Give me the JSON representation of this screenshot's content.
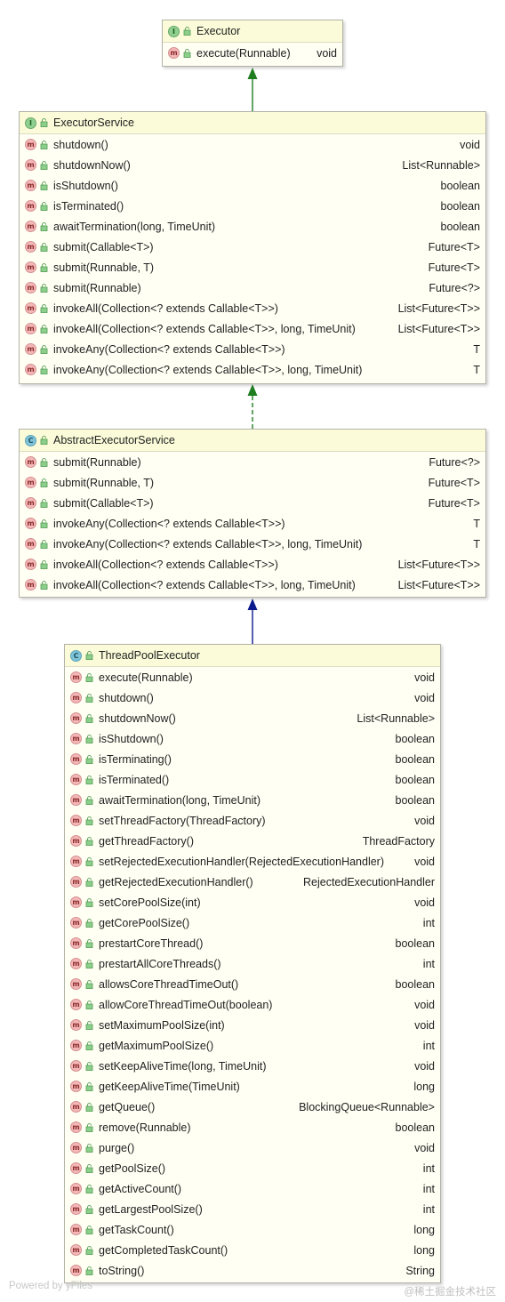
{
  "diagram": {
    "executor": {
      "title": "Executor",
      "kind_icon": "interface-icon",
      "methods": [
        {
          "name": "execute(Runnable)",
          "ret": "void"
        }
      ]
    },
    "executor_service": {
      "title": "ExecutorService",
      "kind_icon": "interface-icon",
      "methods": [
        {
          "name": "shutdown()",
          "ret": "void"
        },
        {
          "name": "shutdownNow()",
          "ret": "List<Runnable>"
        },
        {
          "name": "isShutdown()",
          "ret": "boolean"
        },
        {
          "name": "isTerminated()",
          "ret": "boolean"
        },
        {
          "name": "awaitTermination(long, TimeUnit)",
          "ret": "boolean"
        },
        {
          "name": "submit(Callable<T>)",
          "ret": "Future<T>"
        },
        {
          "name": "submit(Runnable, T)",
          "ret": "Future<T>"
        },
        {
          "name": "submit(Runnable)",
          "ret": "Future<?>"
        },
        {
          "name": "invokeAll(Collection<? extends Callable<T>>)",
          "ret": "List<Future<T>>"
        },
        {
          "name": "invokeAll(Collection<? extends Callable<T>>, long, TimeUnit)",
          "ret": "List<Future<T>>"
        },
        {
          "name": "invokeAny(Collection<? extends Callable<T>>)",
          "ret": "T"
        },
        {
          "name": "invokeAny(Collection<? extends Callable<T>>, long, TimeUnit)",
          "ret": "T"
        }
      ]
    },
    "abstract_executor_service": {
      "title": "AbstractExecutorService",
      "kind_icon": "class-icon",
      "methods": [
        {
          "name": "submit(Runnable)",
          "ret": "Future<?>"
        },
        {
          "name": "submit(Runnable, T)",
          "ret": "Future<T>"
        },
        {
          "name": "submit(Callable<T>)",
          "ret": "Future<T>"
        },
        {
          "name": "invokeAny(Collection<? extends Callable<T>>)",
          "ret": "T"
        },
        {
          "name": "invokeAny(Collection<? extends Callable<T>>, long, TimeUnit)",
          "ret": "T"
        },
        {
          "name": "invokeAll(Collection<? extends Callable<T>>)",
          "ret": "List<Future<T>>"
        },
        {
          "name": "invokeAll(Collection<? extends Callable<T>>, long, TimeUnit)",
          "ret": "List<Future<T>>"
        }
      ]
    },
    "thread_pool_executor": {
      "title": "ThreadPoolExecutor",
      "kind_icon": "class-icon",
      "methods": [
        {
          "name": "execute(Runnable)",
          "ret": "void"
        },
        {
          "name": "shutdown()",
          "ret": "void"
        },
        {
          "name": "shutdownNow()",
          "ret": "List<Runnable>"
        },
        {
          "name": "isShutdown()",
          "ret": "boolean"
        },
        {
          "name": "isTerminating()",
          "ret": "boolean"
        },
        {
          "name": "isTerminated()",
          "ret": "boolean"
        },
        {
          "name": "awaitTermination(long, TimeUnit)",
          "ret": "boolean"
        },
        {
          "name": "setThreadFactory(ThreadFactory)",
          "ret": "void"
        },
        {
          "name": "getThreadFactory()",
          "ret": "ThreadFactory"
        },
        {
          "name": "setRejectedExecutionHandler(RejectedExecutionHandler)",
          "ret": "void"
        },
        {
          "name": "getRejectedExecutionHandler()",
          "ret": "RejectedExecutionHandler"
        },
        {
          "name": "setCorePoolSize(int)",
          "ret": "void"
        },
        {
          "name": "getCorePoolSize()",
          "ret": "int"
        },
        {
          "name": "prestartCoreThread()",
          "ret": "boolean"
        },
        {
          "name": "prestartAllCoreThreads()",
          "ret": "int"
        },
        {
          "name": "allowsCoreThreadTimeOut()",
          "ret": "boolean"
        },
        {
          "name": "allowCoreThreadTimeOut(boolean)",
          "ret": "void"
        },
        {
          "name": "setMaximumPoolSize(int)",
          "ret": "void"
        },
        {
          "name": "getMaximumPoolSize()",
          "ret": "int"
        },
        {
          "name": "setKeepAliveTime(long, TimeUnit)",
          "ret": "void"
        },
        {
          "name": "getKeepAliveTime(TimeUnit)",
          "ret": "long"
        },
        {
          "name": "getQueue()",
          "ret": "BlockingQueue<Runnable>"
        },
        {
          "name": "remove(Runnable)",
          "ret": "boolean"
        },
        {
          "name": "purge()",
          "ret": "void"
        },
        {
          "name": "getPoolSize()",
          "ret": "int"
        },
        {
          "name": "getActiveCount()",
          "ret": "int"
        },
        {
          "name": "getLargestPoolSize()",
          "ret": "int"
        },
        {
          "name": "getTaskCount()",
          "ret": "long"
        },
        {
          "name": "getCompletedTaskCount()",
          "ret": "long"
        },
        {
          "name": "toString()",
          "ret": "String"
        }
      ]
    },
    "badges": {
      "interface": "I",
      "class": "C",
      "method": "m"
    },
    "edges": [
      {
        "from": "ExecutorService",
        "to": "Executor",
        "style": "extends",
        "color": "#1e7d1e"
      },
      {
        "from": "AbstractExecutorService",
        "to": "ExecutorService",
        "style": "implements",
        "color": "#1e7d1e"
      },
      {
        "from": "ThreadPoolExecutor",
        "to": "AbstractExecutorService",
        "style": "extends",
        "color": "#0b1a8c"
      }
    ],
    "footer_left": "Powered by yFiles",
    "footer_right": "@稀土掘金技术社区"
  }
}
